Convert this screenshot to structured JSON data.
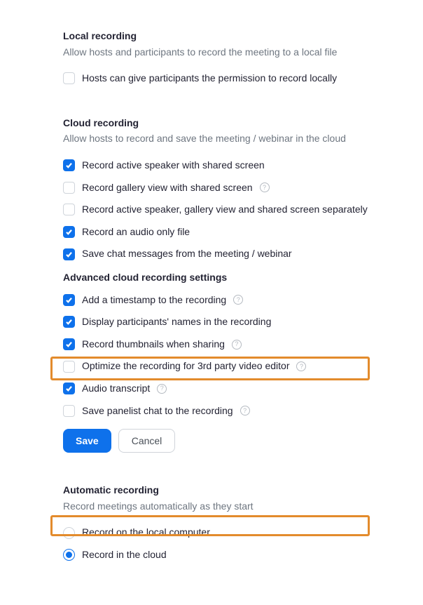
{
  "local_recording": {
    "title": "Local recording",
    "desc": "Allow hosts and participants to record the meeting to a local file",
    "options": [
      {
        "label": "Hosts can give participants the permission to record locally",
        "checked": false,
        "help": false
      }
    ]
  },
  "cloud_recording": {
    "title": "Cloud recording",
    "desc": "Allow hosts to record and save the meeting / webinar in the cloud",
    "options": [
      {
        "label": "Record active speaker with shared screen",
        "checked": true,
        "help": false
      },
      {
        "label": "Record gallery view with shared screen",
        "checked": false,
        "help": true
      },
      {
        "label": "Record active speaker, gallery view and shared screen separately",
        "checked": false,
        "help": false
      },
      {
        "label": "Record an audio only file",
        "checked": true,
        "help": false
      },
      {
        "label": "Save chat messages from the meeting / webinar",
        "checked": true,
        "help": false
      }
    ],
    "advanced_title": "Advanced cloud recording settings",
    "advanced_options": [
      {
        "label": "Add a timestamp to the recording",
        "checked": true,
        "help": true
      },
      {
        "label": "Display participants' names in the recording",
        "checked": true,
        "help": false
      },
      {
        "label": "Record thumbnails when sharing",
        "checked": true,
        "help": true
      },
      {
        "label": "Optimize the recording for 3rd party video editor",
        "checked": false,
        "help": true
      },
      {
        "label": "Audio transcript",
        "checked": true,
        "help": true
      },
      {
        "label": "Save panelist chat to the recording",
        "checked": false,
        "help": true
      }
    ],
    "save_label": "Save",
    "cancel_label": "Cancel"
  },
  "automatic_recording": {
    "title": "Automatic recording",
    "desc": "Record meetings automatically as they start",
    "options": [
      {
        "label": "Record on the local computer",
        "selected": false
      },
      {
        "label": "Record in the cloud",
        "selected": true
      }
    ]
  }
}
